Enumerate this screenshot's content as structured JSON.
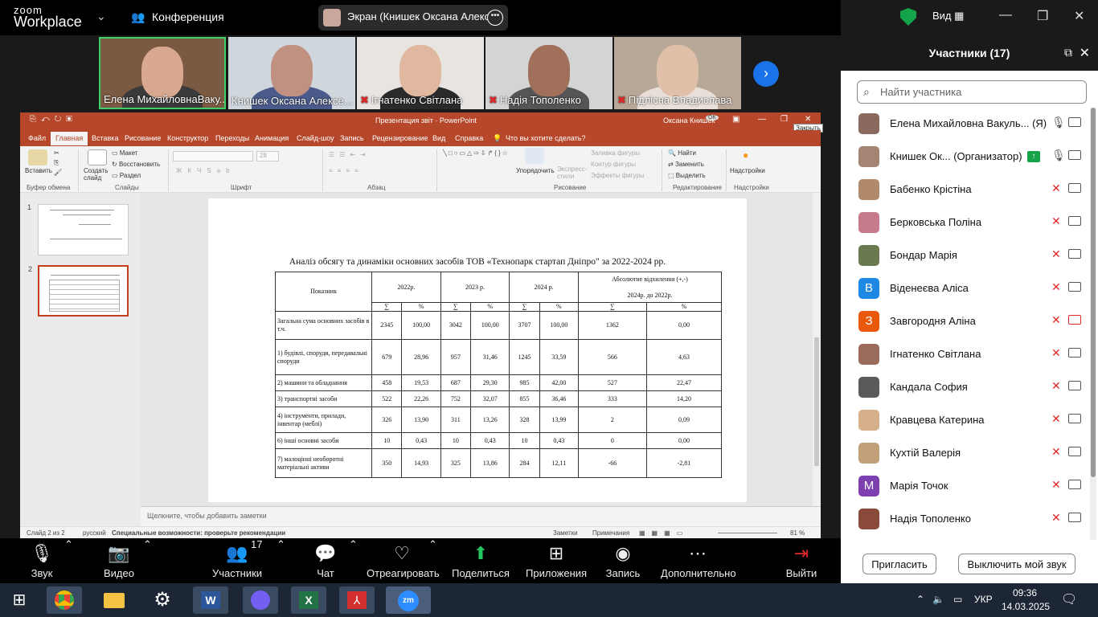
{
  "zoom": {
    "logo_line1": "zoom",
    "logo_line2": "Workplace",
    "meeting_label": "Конференция",
    "screen_share_label": "Экран (Книшек Оксана Алексее",
    "view_label": "Вид",
    "accent": "#1a73e8",
    "muted_color": "#e02828"
  },
  "gallery": [
    {
      "name": "Елена МихайловнаВаку...",
      "muted": false,
      "active": true
    },
    {
      "name": "Книшек Оксана Алексе...",
      "muted": false,
      "active": false
    },
    {
      "name": "Ігнатенко Світлана",
      "muted": true,
      "active": false
    },
    {
      "name": "Надія Тополенко",
      "muted": true,
      "active": false
    },
    {
      "name": "Підлісна Владислава",
      "muted": true,
      "active": false
    }
  ],
  "ppt": {
    "title": "Презентация звіт · PowerPoint",
    "user": "Оксана Книшек",
    "user_initials": "ОК",
    "close_tooltip": "Закрыть",
    "tabs": [
      "Файл",
      "Главная",
      "Вставка",
      "Рисование",
      "Конструктор",
      "Переходы",
      "Анимация",
      "Слайд-шоу",
      "Запись",
      "Рецензирование",
      "Вид",
      "Справка"
    ],
    "active_tab": "Главная",
    "tell_me": "Что вы хотите сделать?",
    "ribbon": {
      "paste": "Вставить",
      "clipboard_group": "Буфер обмена",
      "new_slide": "Создать слайд",
      "layout": "Макет",
      "reset": "Восстановить",
      "section": "Раздел",
      "slides_group": "Слайды",
      "font_size": "28",
      "font_group": "Шрифт",
      "paragraph_group": "Абзац",
      "arrange": "Упорядочить",
      "quick_styles": "Экспресс-стили",
      "shape_fill": "Заливка фигуры",
      "shape_outline": "Контур фигуры",
      "shape_effects": "Эффекты фигуры",
      "drawing_group": "Рисование",
      "find": "Найти",
      "replace": "Заменить",
      "select": "Выделить",
      "editing_group": "Редактирование",
      "addins": "Надстройки",
      "addins_group": "Надстройки"
    },
    "slide_numbers": [
      "1",
      "2"
    ],
    "notes_placeholder": "Щелкните, чтобы добавить заметки",
    "status": {
      "slide": "Слайд 2 из 2",
      "lang": "русский",
      "accessibility": "Специальные возможности: проверьте рекомендации",
      "notes": "Заметки",
      "comments": "Примечания",
      "zoom": "81 %"
    }
  },
  "slide": {
    "title": "Аналіз обсягу та динаміки основних засобів ТОВ «Технопарк стартап Дніпро\" за 2022-2024 рр.",
    "header": {
      "indicator": "Показник",
      "y2022": "2022р.",
      "y2023": "2023 р.",
      "y2024": "2024 р.",
      "abs_line1": "Абсолютне відхилення (+,-)",
      "abs_line2": "2024р. до 2022р.",
      "sum": "∑",
      "pct": "%"
    },
    "rows": [
      {
        "label": "Загальна сума основних засобів в т.ч.",
        "v": [
          "2345",
          "100,00",
          "3042",
          "100,00",
          "3707",
          "100,00",
          "1362",
          "0,00"
        ]
      },
      {
        "label": "1) будівлі, споруди, передавальні споруди",
        "v": [
          "679",
          "28,96",
          "957",
          "31,46",
          "1245",
          "33,59",
          "566",
          "4,63"
        ]
      },
      {
        "label": "2) машини  та обладнання",
        "v": [
          "458",
          "19,53",
          "687",
          "29,30",
          "985",
          "42,00",
          "527",
          "22,47"
        ]
      },
      {
        "label": "3) транспортні засоби",
        "v": [
          "522",
          "22,26",
          "752",
          "32,07",
          "855",
          "36,46",
          "333",
          "14,20"
        ]
      },
      {
        "label": "4) інструменти, прилади, інвентар (меблі)",
        "v": [
          "326",
          "13,90",
          "311",
          "13,26",
          "328",
          "13,99",
          "2",
          "0,09"
        ]
      },
      {
        "label": "6) інші основні засоби",
        "v": [
          "10",
          "0,43",
          "10",
          "0,43",
          "10",
          "0,43",
          "0",
          "0,00"
        ]
      },
      {
        "label": "7) малоцінні необоротні матеріальні активи",
        "v": [
          "350",
          "14,93",
          "325",
          "13,86",
          "284",
          "12,11",
          "-66",
          "-2,81"
        ]
      }
    ]
  },
  "participants": {
    "title": "Участники (17)",
    "search_placeholder": "Найти участника",
    "items": [
      {
        "name": "Елена Михайловна Вакуль... (Я)",
        "initial": "",
        "color": "#8a6a5e",
        "mic": "on",
        "cam": "off-plain"
      },
      {
        "name": "Книшек Ок... (Организатор)",
        "initial": "",
        "color": "#a48472",
        "mic": "on",
        "cam": "off-plain"
      },
      {
        "name": "Бабенко Крістіна",
        "initial": "",
        "color": "#b08a6a",
        "mic": "muted",
        "cam": "off-plain"
      },
      {
        "name": "Берковська Поліна",
        "initial": "",
        "color": "#c77a8c",
        "mic": "muted",
        "cam": "off-plain"
      },
      {
        "name": "Бондар Марія",
        "initial": "",
        "color": "#6a7a4e",
        "mic": "muted",
        "cam": "off-plain"
      },
      {
        "name": "Віденеєва Аліса",
        "initial": "В",
        "color": "#1e88e5",
        "mic": "muted",
        "cam": "off-plain"
      },
      {
        "name": "Завгородня Аліна",
        "initial": "З",
        "color": "#e8590c",
        "mic": "muted",
        "cam": "off-red"
      },
      {
        "name": "Ігнатенко Світлана",
        "initial": "",
        "color": "#9a6a5a",
        "mic": "muted",
        "cam": "off-plain"
      },
      {
        "name": "Кандала София",
        "initial": "",
        "color": "#5a5a5a",
        "mic": "muted",
        "cam": "off-plain"
      },
      {
        "name": "Кравцева Катерина",
        "initial": "",
        "color": "#d6b08a",
        "mic": "muted",
        "cam": "off-plain"
      },
      {
        "name": "Кухтій Валерія",
        "initial": "",
        "color": "#c2a07a",
        "mic": "muted",
        "cam": "off-plain"
      },
      {
        "name": "Марія Точок",
        "initial": "М",
        "color": "#7e3fb0",
        "mic": "muted",
        "cam": "off-plain"
      },
      {
        "name": "Надія Тополенко",
        "initial": "",
        "color": "#8a4a3a",
        "mic": "muted",
        "cam": "off-plain"
      }
    ],
    "invite_label": "Пригласить",
    "mute_me_label": "Выключить мой звук"
  },
  "toolbar": {
    "audio": "Звук",
    "video": "Видео",
    "participants": "Участники",
    "participants_count": "17",
    "chat": "Чат",
    "react": "Отреагировать",
    "share": "Поделиться",
    "apps": "Приложения",
    "record": "Запись",
    "more": "Дополнительно",
    "leave": "Выйти"
  },
  "taskbar": {
    "lang": "УКР",
    "time": "09:36",
    "date": "14.03.2025",
    "apps": [
      "start-icon",
      "chrome-icon",
      "explorer-icon",
      "settings-icon",
      "word-icon",
      "viber-icon",
      "excel-icon",
      "acrobat-icon",
      "zoom-icon"
    ]
  }
}
